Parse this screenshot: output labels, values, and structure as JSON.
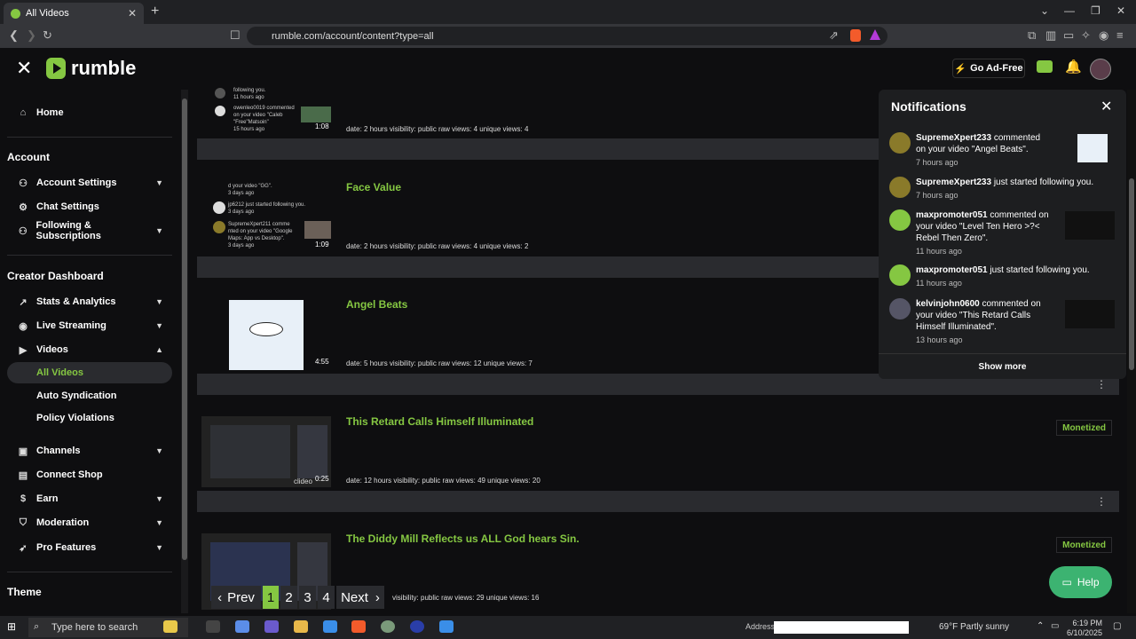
{
  "browser": {
    "tab_title": "All Videos",
    "url": "rumble.com/account/content?type=all"
  },
  "header": {
    "logo_text": "rumble",
    "go_ad_free": "Go Ad-Free"
  },
  "sidebar": {
    "home": "Home",
    "account_heading": "Account",
    "account_settings": "Account Settings",
    "chat_settings": "Chat Settings",
    "following": "Following & Subscriptions",
    "creator_heading": "Creator Dashboard",
    "stats": "Stats & Analytics",
    "live": "Live Streaming",
    "videos": "Videos",
    "all_videos": "All Videos",
    "auto_sync": "Auto Syndication",
    "policy": "Policy Violations",
    "channels": "Channels",
    "connect_shop": "Connect Shop",
    "earn": "Earn",
    "moderation": "Moderation",
    "pro_features": "Pro Features",
    "theme_heading": "Theme"
  },
  "videos": [
    {
      "title": "",
      "meta": "date: 2 hours  visibility: public  raw views: 4  unique views: 4",
      "duration": "1:08",
      "thumb_lines": [
        "following you.",
        "11 hours ago",
        "owenleo0019 commented",
        "on your video \"Caleb",
        "\"Free\"Matsoin\"",
        "15 hours ago"
      ]
    },
    {
      "title": "Face Value",
      "meta": "date: 2 hours  visibility: public  raw views: 4  unique views: 2",
      "duration": "1:09",
      "thumb_lines": [
        "d your video \"GG\".",
        "3 days ago",
        "jp6212 just started following you.",
        "3 days ago",
        "SupremeXpert211 comme",
        "nted on your video \"Google",
        "Maps: App vs Desktop\".",
        "3 days ago"
      ]
    },
    {
      "title": "Angel Beats",
      "meta": "date: 5 hours  visibility: public  raw views: 12  unique views: 7",
      "duration": "4:55"
    },
    {
      "title": "This Retard Calls Himself Illuminated",
      "meta": "date: 12 hours  visibility: public  raw views: 49  unique views: 20",
      "duration": "0:25",
      "badge": "Monetized",
      "watermark": "clideo"
    },
    {
      "title": "The Diddy Mill Reflects us ALL God hears Sin.",
      "meta": "visibility: public  raw views: 29  unique views: 16",
      "badge": "Monetized"
    }
  ],
  "pagination": {
    "prev": "Prev",
    "pages": [
      "1",
      "2",
      "3",
      "4"
    ],
    "current": "1",
    "next": "Next"
  },
  "notifications": {
    "title": "Notifications",
    "show_more": "Show more",
    "items": [
      {
        "user": "SupremeXpert233",
        "text": "commented on your video \"Angel Beats\".",
        "time": "7 hours ago",
        "avatar_color": "#8a7a2a"
      },
      {
        "user": "SupremeXpert233",
        "text": "just started following you.",
        "time": "7 hours ago",
        "avatar_color": "#8a7a2a"
      },
      {
        "user": "maxpromoter051",
        "text": "commented on your video \"Level Ten Hero >?< Rebel Then Zero\".",
        "time": "11 hours ago",
        "avatar_color": "#85c742"
      },
      {
        "user": "maxpromoter051",
        "text": "just started following you.",
        "time": "11 hours ago",
        "avatar_color": "#85c742"
      },
      {
        "user": "kelvinjohn0600",
        "text": "commented on your video \"This Retard Calls Himself Illuminated\".",
        "time": "13 hours ago",
        "avatar_color": "#556"
      }
    ]
  },
  "help": "Help",
  "taskbar": {
    "search_placeholder": "Type here to search",
    "address_label": "Address",
    "weather": "69°F  Partly sunny",
    "time": "6:19 PM",
    "date": "6/10/2025"
  },
  "colors": {
    "accent": "#85c742",
    "bg": "#0e0e10",
    "panel": "#1d1e20",
    "separator": "#2a2b2f"
  }
}
